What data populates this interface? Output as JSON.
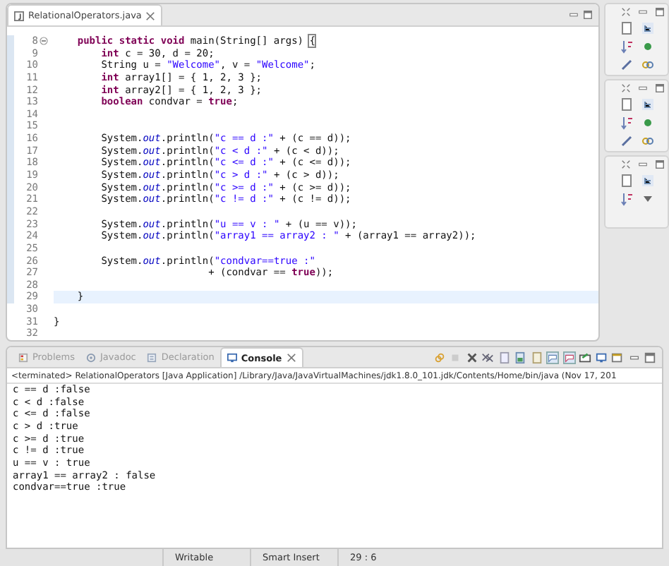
{
  "editor": {
    "tab": {
      "title": "RelationalOperators.java",
      "selected": true
    },
    "lines": [
      {
        "number": "8",
        "fold": true,
        "current": false,
        "tokens": [
          {
            "kind": "keyword",
            "text": "    public static void"
          },
          {
            "kind": "plain",
            "text": " main(String[] args) "
          },
          {
            "kind": "bracket",
            "text": "{"
          }
        ]
      },
      {
        "number": "9",
        "fold": false,
        "current": false,
        "tokens": [
          {
            "kind": "keyword",
            "text": "        int"
          },
          {
            "kind": "plain",
            "text": " c = 30, d = 20;"
          }
        ]
      },
      {
        "number": "10",
        "fold": false,
        "current": false,
        "tokens": [
          {
            "kind": "plain",
            "text": "        String u = "
          },
          {
            "kind": "string",
            "text": "\"Welcome\""
          },
          {
            "kind": "plain",
            "text": ", v = "
          },
          {
            "kind": "string",
            "text": "\"Welcome\""
          },
          {
            "kind": "plain",
            "text": ";"
          }
        ]
      },
      {
        "number": "11",
        "fold": false,
        "current": false,
        "tokens": [
          {
            "kind": "keyword",
            "text": "        int"
          },
          {
            "kind": "plain",
            "text": " array1[] = { 1, 2, 3 };"
          }
        ]
      },
      {
        "number": "12",
        "fold": false,
        "current": false,
        "tokens": [
          {
            "kind": "keyword",
            "text": "        int"
          },
          {
            "kind": "plain",
            "text": " array2[] = { 1, 2, 3 };"
          }
        ]
      },
      {
        "number": "13",
        "fold": false,
        "current": false,
        "tokens": [
          {
            "kind": "keyword",
            "text": "        boolean"
          },
          {
            "kind": "plain",
            "text": " condvar = "
          },
          {
            "kind": "keyword",
            "text": "true"
          },
          {
            "kind": "plain",
            "text": ";"
          }
        ]
      },
      {
        "number": "14",
        "fold": false,
        "current": false
      },
      {
        "number": "15",
        "fold": false,
        "current": false
      },
      {
        "number": "16",
        "fold": false,
        "current": false,
        "tokens": [
          {
            "kind": "plain",
            "text": "        System."
          },
          {
            "kind": "field",
            "text": "out"
          },
          {
            "kind": "plain",
            "text": ".println("
          },
          {
            "kind": "string",
            "text": "\"c == d :\""
          },
          {
            "kind": "plain",
            "text": " + (c == d));"
          }
        ]
      },
      {
        "number": "17",
        "fold": false,
        "current": false,
        "tokens": [
          {
            "kind": "plain",
            "text": "        System."
          },
          {
            "kind": "field",
            "text": "out"
          },
          {
            "kind": "plain",
            "text": ".println("
          },
          {
            "kind": "string",
            "text": "\"c < d :\""
          },
          {
            "kind": "plain",
            "text": " + (c < d));"
          }
        ]
      },
      {
        "number": "18",
        "fold": false,
        "current": false,
        "tokens": [
          {
            "kind": "plain",
            "text": "        System."
          },
          {
            "kind": "field",
            "text": "out"
          },
          {
            "kind": "plain",
            "text": ".println("
          },
          {
            "kind": "string",
            "text": "\"c <= d :\""
          },
          {
            "kind": "plain",
            "text": " + (c <= d));"
          }
        ]
      },
      {
        "number": "19",
        "fold": false,
        "current": false,
        "tokens": [
          {
            "kind": "plain",
            "text": "        System."
          },
          {
            "kind": "field",
            "text": "out"
          },
          {
            "kind": "plain",
            "text": ".println("
          },
          {
            "kind": "string",
            "text": "\"c > d :\""
          },
          {
            "kind": "plain",
            "text": " + (c > d));"
          }
        ]
      },
      {
        "number": "20",
        "fold": false,
        "current": false,
        "tokens": [
          {
            "kind": "plain",
            "text": "        System."
          },
          {
            "kind": "field",
            "text": "out"
          },
          {
            "kind": "plain",
            "text": ".println("
          },
          {
            "kind": "string",
            "text": "\"c >= d :\""
          },
          {
            "kind": "plain",
            "text": " + (c >= d));"
          }
        ]
      },
      {
        "number": "21",
        "fold": false,
        "current": false,
        "tokens": [
          {
            "kind": "plain",
            "text": "        System."
          },
          {
            "kind": "field",
            "text": "out"
          },
          {
            "kind": "plain",
            "text": ".println("
          },
          {
            "kind": "string",
            "text": "\"c != d :\""
          },
          {
            "kind": "plain",
            "text": " + (c != d));"
          }
        ]
      },
      {
        "number": "22",
        "fold": false,
        "current": false
      },
      {
        "number": "23",
        "fold": false,
        "current": false,
        "tokens": [
          {
            "kind": "plain",
            "text": "        System."
          },
          {
            "kind": "field",
            "text": "out"
          },
          {
            "kind": "plain",
            "text": ".println("
          },
          {
            "kind": "string",
            "text": "\"u == v : \""
          },
          {
            "kind": "plain",
            "text": " + (u == v));"
          }
        ]
      },
      {
        "number": "24",
        "fold": false,
        "current": false,
        "tokens": [
          {
            "kind": "plain",
            "text": "        System."
          },
          {
            "kind": "field",
            "text": "out"
          },
          {
            "kind": "plain",
            "text": ".println("
          },
          {
            "kind": "string",
            "text": "\"array1 == array2 : \""
          },
          {
            "kind": "plain",
            "text": " + (array1 == array2));"
          }
        ]
      },
      {
        "number": "25",
        "fold": false,
        "current": false
      },
      {
        "number": "26",
        "fold": false,
        "current": false,
        "tokens": [
          {
            "kind": "plain",
            "text": "        System."
          },
          {
            "kind": "field",
            "text": "out"
          },
          {
            "kind": "plain",
            "text": ".println("
          },
          {
            "kind": "string",
            "text": "\"condvar==true :\""
          }
        ]
      },
      {
        "number": "27",
        "fold": false,
        "current": false,
        "tokens": [
          {
            "kind": "plain",
            "text": "                          + (condvar == "
          },
          {
            "kind": "keyword",
            "text": "true"
          },
          {
            "kind": "plain",
            "text": "));"
          }
        ]
      },
      {
        "number": "28",
        "fold": false,
        "current": false
      },
      {
        "number": "29",
        "fold": false,
        "current": true,
        "tokens": [
          {
            "kind": "plain",
            "text": "    }"
          }
        ]
      },
      {
        "number": "30",
        "fold": false,
        "current": false
      },
      {
        "number": "31",
        "fold": false,
        "current": false,
        "tokens": [
          {
            "kind": "plain",
            "text": "}"
          }
        ]
      },
      {
        "number": "32",
        "fold": false,
        "current": false
      }
    ]
  },
  "console": {
    "tabs": [
      {
        "label": "Problems",
        "selected": false
      },
      {
        "label": "Javadoc",
        "selected": false
      },
      {
        "label": "Declaration",
        "selected": false
      },
      {
        "label": "Console",
        "selected": true
      }
    ],
    "header": "<terminated> RelationalOperators [Java Application] /Library/Java/JavaVirtualMachines/jdk1.8.0_101.jdk/Contents/Home/bin/java (Nov 17, 201",
    "output": [
      "c == d :false",
      "c < d :false",
      "c <= d :false",
      "c > d :true",
      "c >= d :true",
      "c != d :true",
      "u == v : true",
      "array1 == array2 : false",
      "condvar==true :true"
    ]
  },
  "status_bar": [
    "Writable",
    "Smart Insert",
    "29 : 6"
  ]
}
